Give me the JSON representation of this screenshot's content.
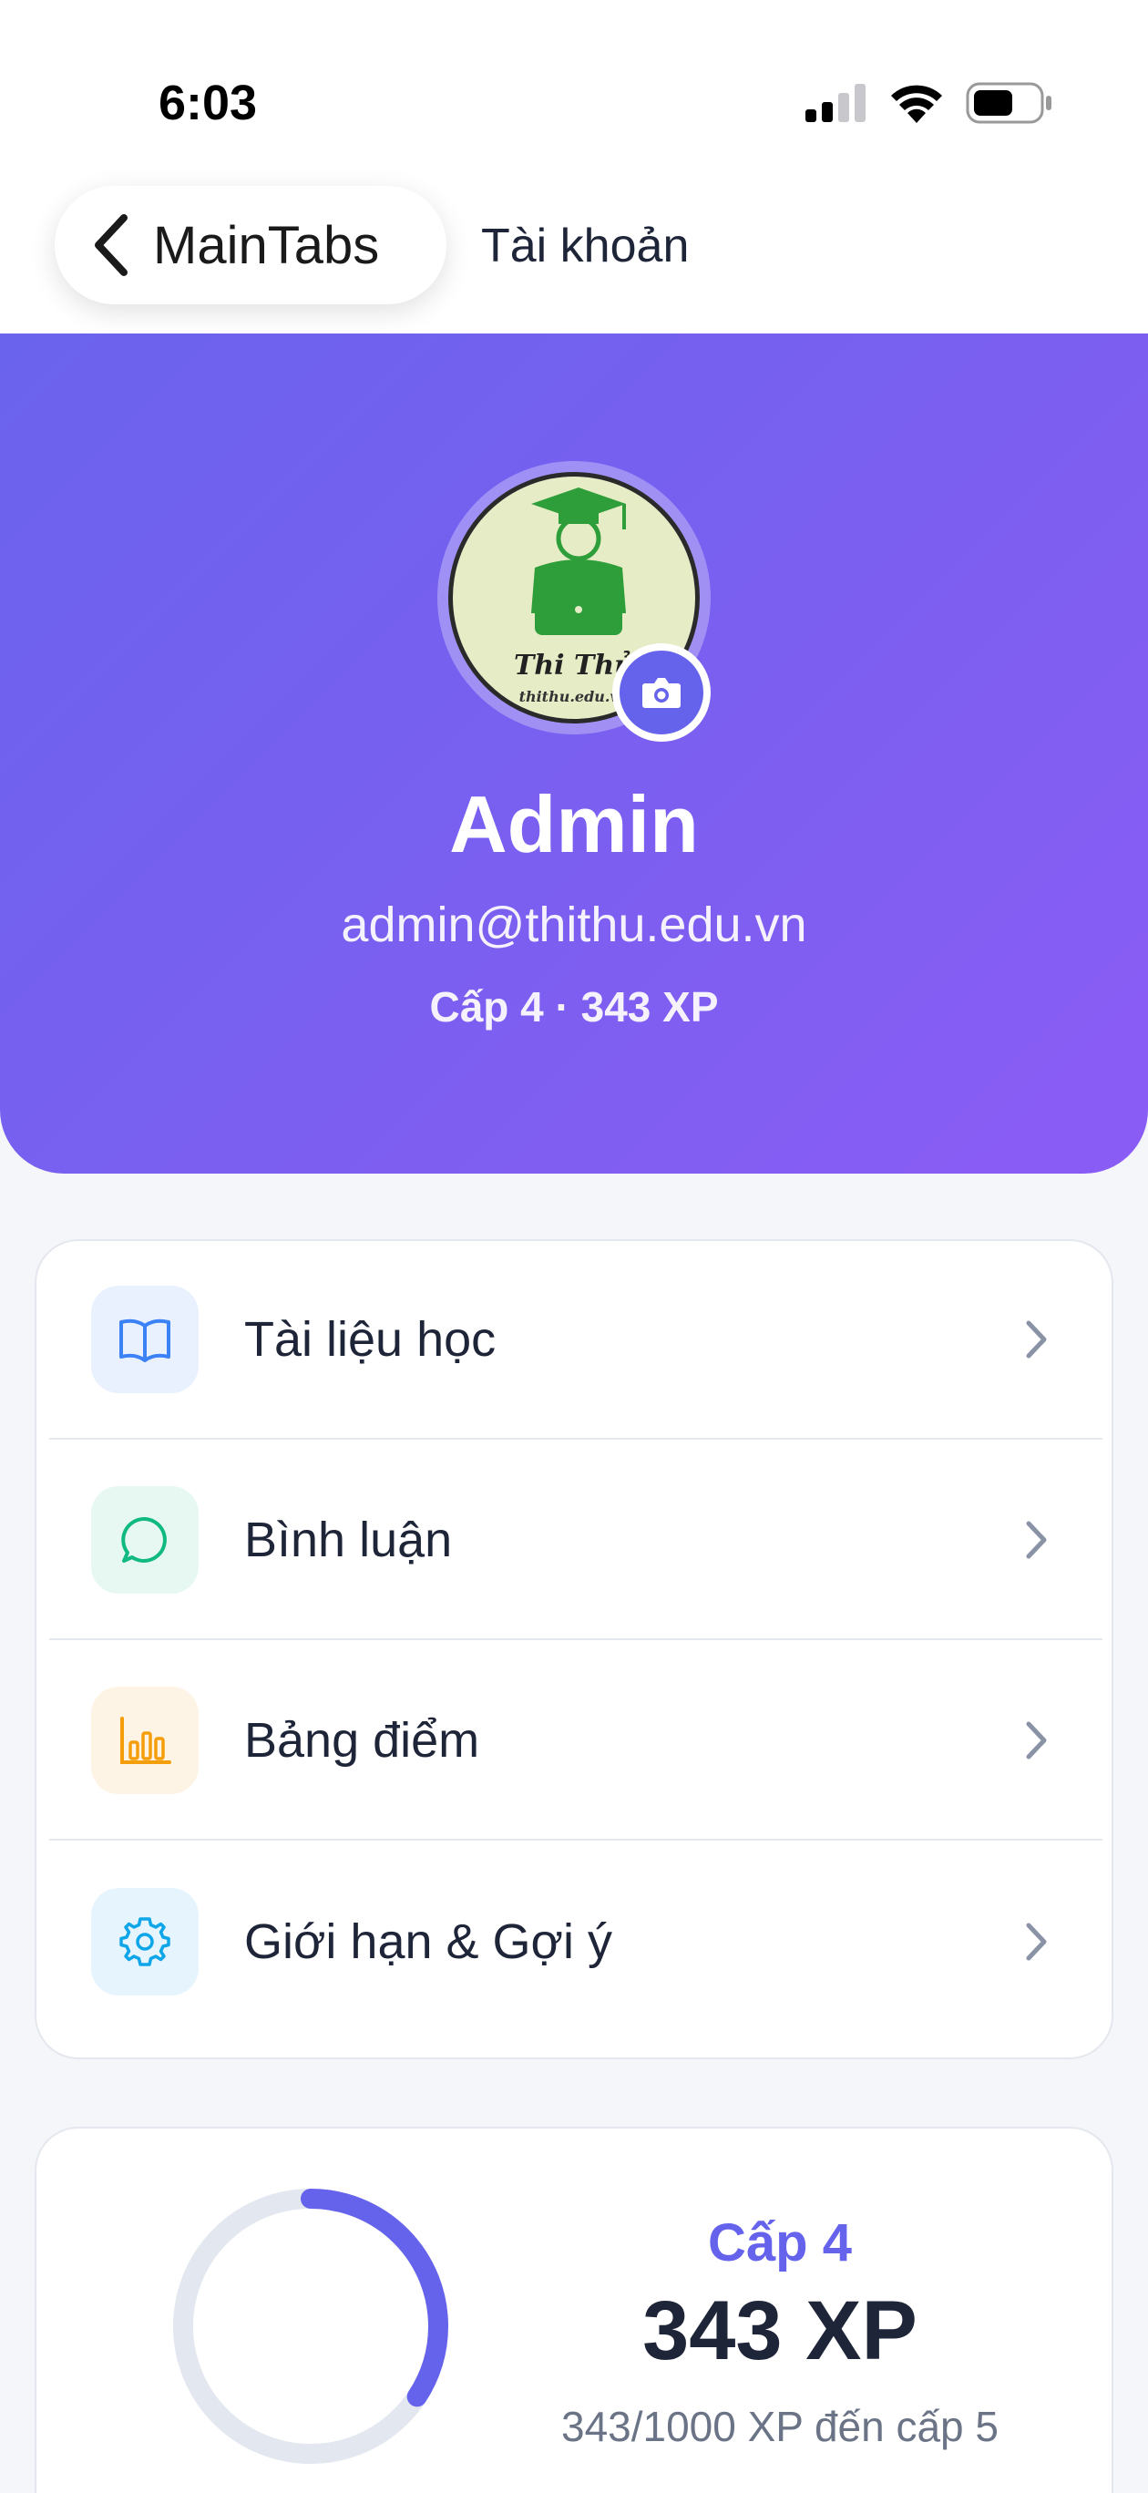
{
  "status_bar": {
    "time": "6:03"
  },
  "nav": {
    "back_label": "MainTabs",
    "title": "Tài khoản"
  },
  "profile": {
    "avatar_text": "Thi Thử",
    "avatar_subtext": "thithu.edu.vn",
    "name": "Admin",
    "email": "admin@thithu.edu.vn",
    "level_summary": "Cấp 4 · 343 XP"
  },
  "menu": {
    "items": [
      {
        "label": "Tài liệu học",
        "icon": "book-icon",
        "icon_color": "#3b82f6",
        "icon_bg": "#eaf1fe"
      },
      {
        "label": "Bình luận",
        "icon": "chat-bubble-icon",
        "icon_color": "#10b981",
        "icon_bg": "#e6f8f1"
      },
      {
        "label": "Bảng điểm",
        "icon": "bar-chart-icon",
        "icon_color": "#f59e0b",
        "icon_bg": "#fef4e6"
      },
      {
        "label": "Giới hạn & Gợi ý",
        "icon": "gear-icon",
        "icon_color": "#0ea5e9",
        "icon_bg": "#e6f5fd"
      }
    ]
  },
  "xp": {
    "level": "Cấp 4",
    "value": "343 XP",
    "progress_text": "343/1000 XP đến cấp 5",
    "progress_fraction": 0.343
  },
  "colors": {
    "accent": "#6563ec",
    "hero_gradient_start": "#6a63ee",
    "hero_gradient_end": "#8b5cf6"
  }
}
